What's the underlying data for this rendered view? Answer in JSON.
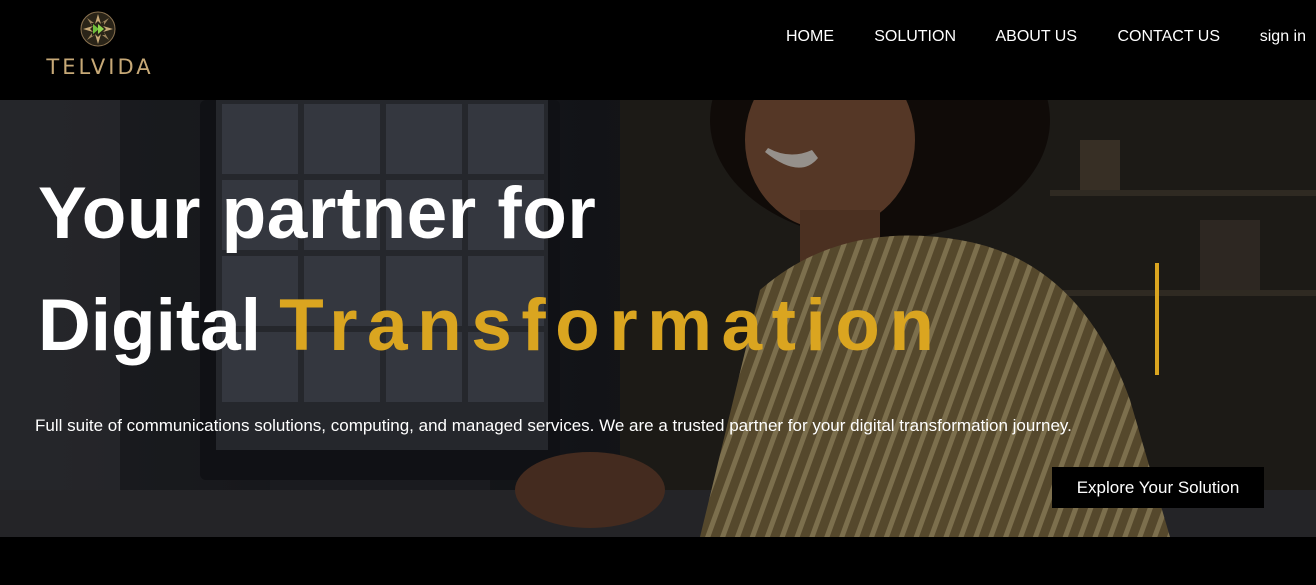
{
  "brand": {
    "name": "TELVIDA",
    "logo_icon": "telvida-star-globe-icon",
    "accent_color": "#daa520",
    "logo_text_color": "#c7a977"
  },
  "nav": {
    "items": [
      {
        "label": "HOME"
      },
      {
        "label": "SOLUTION"
      },
      {
        "label": "ABOUT US"
      },
      {
        "label": "CONTACT US"
      },
      {
        "label": "sign in"
      }
    ]
  },
  "hero": {
    "headline_line1": "Your partner for",
    "headline_line2_plain": "Digital",
    "headline_line2_accent": "Transformation",
    "subtitle": "Full suite of communications solutions, computing, and managed services. We are a trusted partner for your digital transformation journey.",
    "cta_label": "Explore Your Solution",
    "background_image": "woman-on-video-call-photo"
  }
}
